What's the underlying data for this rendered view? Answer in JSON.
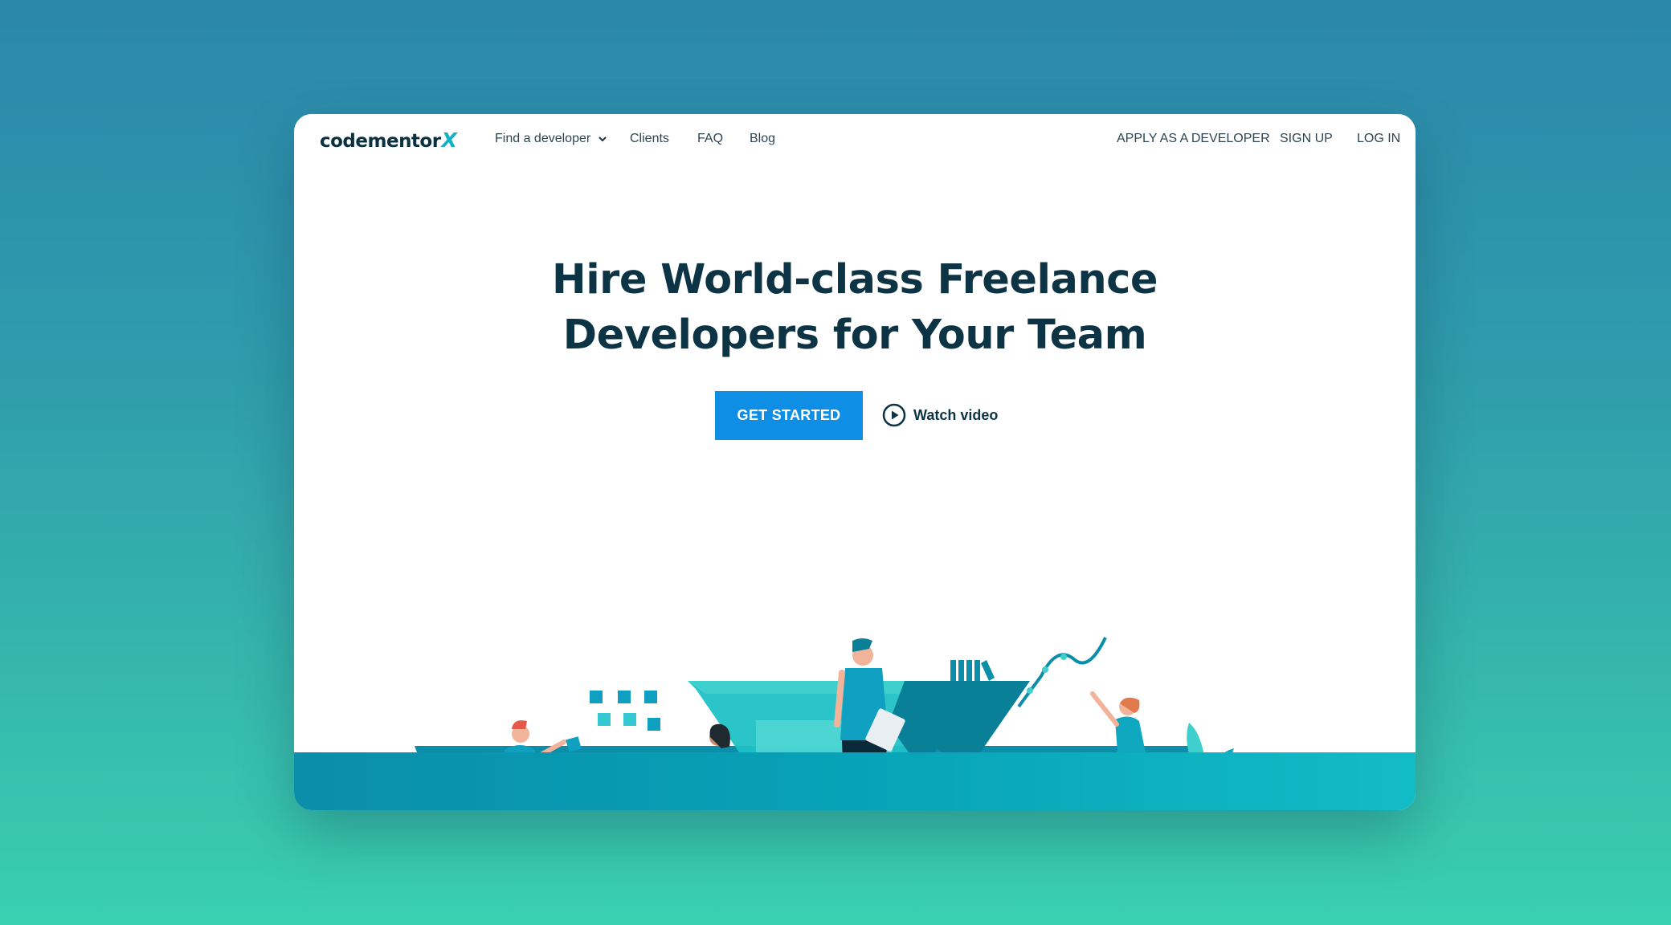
{
  "brand": {
    "logo_text": "codementor",
    "logo_mark": "X",
    "colors": {
      "primary_button": "#0f8ee6",
      "heading": "#0d3444",
      "accent": "#14b0c8",
      "teal": "#0b94ae"
    }
  },
  "nav": {
    "left": [
      {
        "label": "Find a developer",
        "has_dropdown": true
      },
      {
        "label": "Clients"
      },
      {
        "label": "FAQ"
      },
      {
        "label": "Blog"
      }
    ],
    "right": [
      {
        "label": "APPLY AS A DEVELOPER"
      },
      {
        "label": "SIGN UP"
      },
      {
        "label": "LOG IN"
      }
    ]
  },
  "hero": {
    "title_line1": "Hire World-class Freelance",
    "title_line2": "Developers for Your Team",
    "cta_label": "GET STARTED",
    "video_label": "Watch video",
    "video_icon": "play-circle-icon"
  },
  "illustration": {
    "description_icon": "team-collaboration-illustration"
  }
}
